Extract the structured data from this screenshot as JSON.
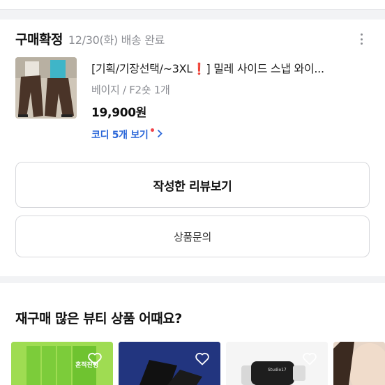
{
  "order": {
    "status": "구매확정",
    "date_text": "12/30(화) 배송 완료",
    "product_name_prefix": "[기획/기장선택/~3XL",
    "product_name_emoji": "❗",
    "product_name_suffix": "] 밀레 사이드 스냅 와이...",
    "option": "베이지 / F2숏 1개",
    "price": "19,900원",
    "codi_link": "코디 5개 보기",
    "review_button": "작성한 리뷰보기",
    "inquiry_button": "상품문의"
  },
  "recommend": {
    "title": "재구매 많은 뷰티 상품 어때요?",
    "tiles": [
      {
        "icon": "heart-outline-icon",
        "label": "혼적진정"
      },
      {
        "icon": "heart-outline-icon"
      },
      {
        "icon": "heart-outline-icon",
        "label": "Studio17"
      },
      {
        "icon": "heart-outline-icon"
      }
    ]
  },
  "colors": {
    "link_blue": "#2a66d8",
    "dot_red": "#f0444b",
    "muted_text": "#8b8d93"
  }
}
